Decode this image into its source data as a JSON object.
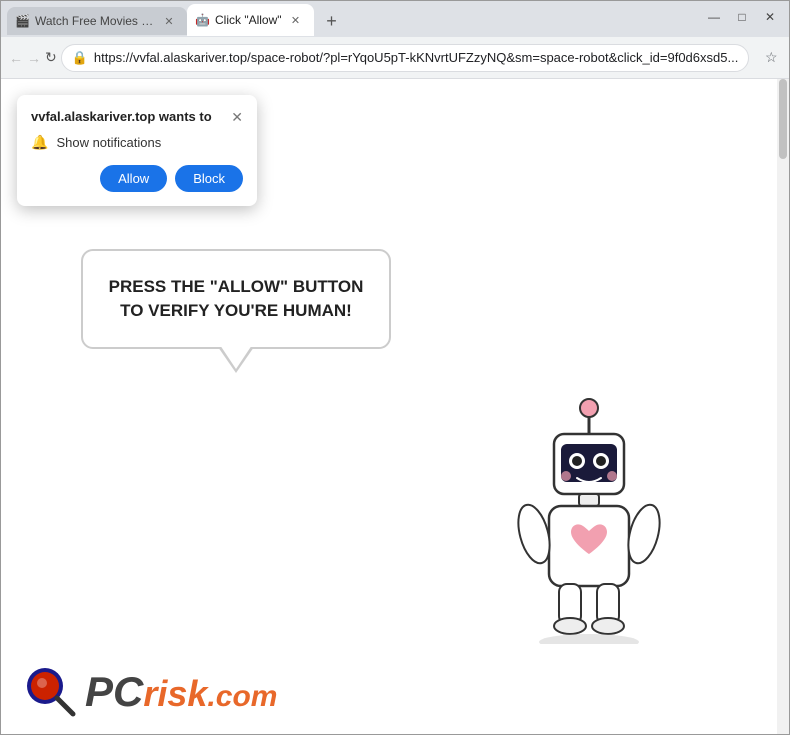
{
  "window": {
    "tabs": [
      {
        "label": "Watch Free Movies - 123movie...",
        "favicon": "🎬",
        "active": false
      },
      {
        "label": "Click \"Allow\"",
        "favicon": "🤖",
        "active": true
      }
    ],
    "address_bar": {
      "url": "https://vvfal.alaskariver.top/space-robot/?pl=rYqoU5pT-kKNvrtUFZzyNQ&sm=space-robot&click_id=9f0d6xsd5...",
      "security_icon": "🔒"
    },
    "controls": {
      "minimize": "—",
      "maximize": "□",
      "close": "✕"
    }
  },
  "popup": {
    "title": "vvfal.alaskariver.top wants to",
    "close_label": "✕",
    "notification_label": "Show notifications",
    "allow_label": "Allow",
    "block_label": "Block"
  },
  "page": {
    "speech_text": "PRESS THE \"ALLOW\" BUTTON TO VERIFY YOU'RE HUMAN!",
    "robot_alt": "space robot character"
  },
  "branding": {
    "logo_text_pc": "PC",
    "logo_text_risk": "risk",
    "logo_text_domain": ".com"
  },
  "nav": {
    "back_label": "←",
    "forward_label": "→",
    "reload_label": "↻",
    "new_tab_label": "+"
  }
}
